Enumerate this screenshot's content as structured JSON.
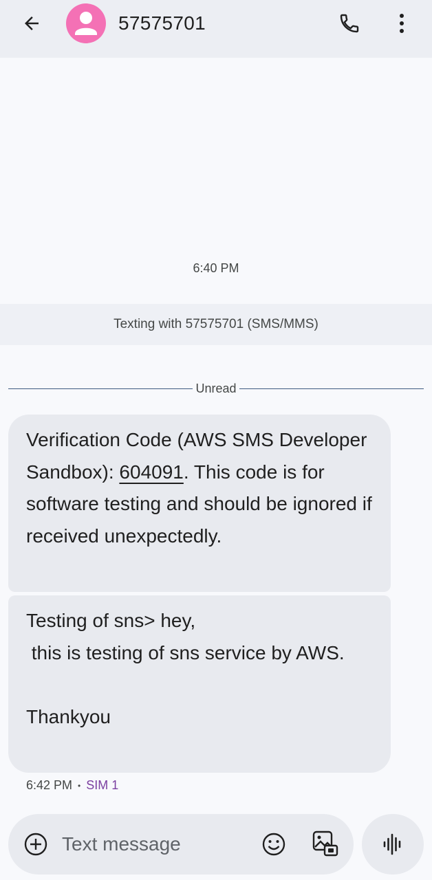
{
  "header": {
    "contact": "57575701",
    "icons": [
      "back-arrow-icon",
      "avatar-person-icon",
      "phone-icon",
      "more-vert-icon"
    ]
  },
  "conversation": {
    "timestamp": "6:40 PM",
    "texting_with": "Texting with 57575701 (SMS/MMS)",
    "unread_label": "Unread",
    "messages": [
      {
        "prefix": "Verification Code (AWS SMS Developer Sandbox): ",
        "code": "604091",
        "suffix": ". This code is for software testing and should be ignored if received unexpectedly."
      },
      {
        "text": "Testing of sns> hey,\n this is testing of sns service by AWS.\n\nThankyou"
      }
    ],
    "meta": {
      "time": "6:42 PM",
      "separator": "•",
      "sim": "SIM 1"
    }
  },
  "composer": {
    "placeholder": "Text message",
    "icons": [
      "add-icon",
      "emoji-icon",
      "gallery-icon",
      "voice-waveform-icon"
    ]
  },
  "colors": {
    "app_bar": "#eceef3",
    "background": "#f8f9fc",
    "bubble": "#e8eaef",
    "avatar": "#f471b5",
    "sim_label": "#7b3fa0",
    "unread_line": "#3d5a80"
  }
}
